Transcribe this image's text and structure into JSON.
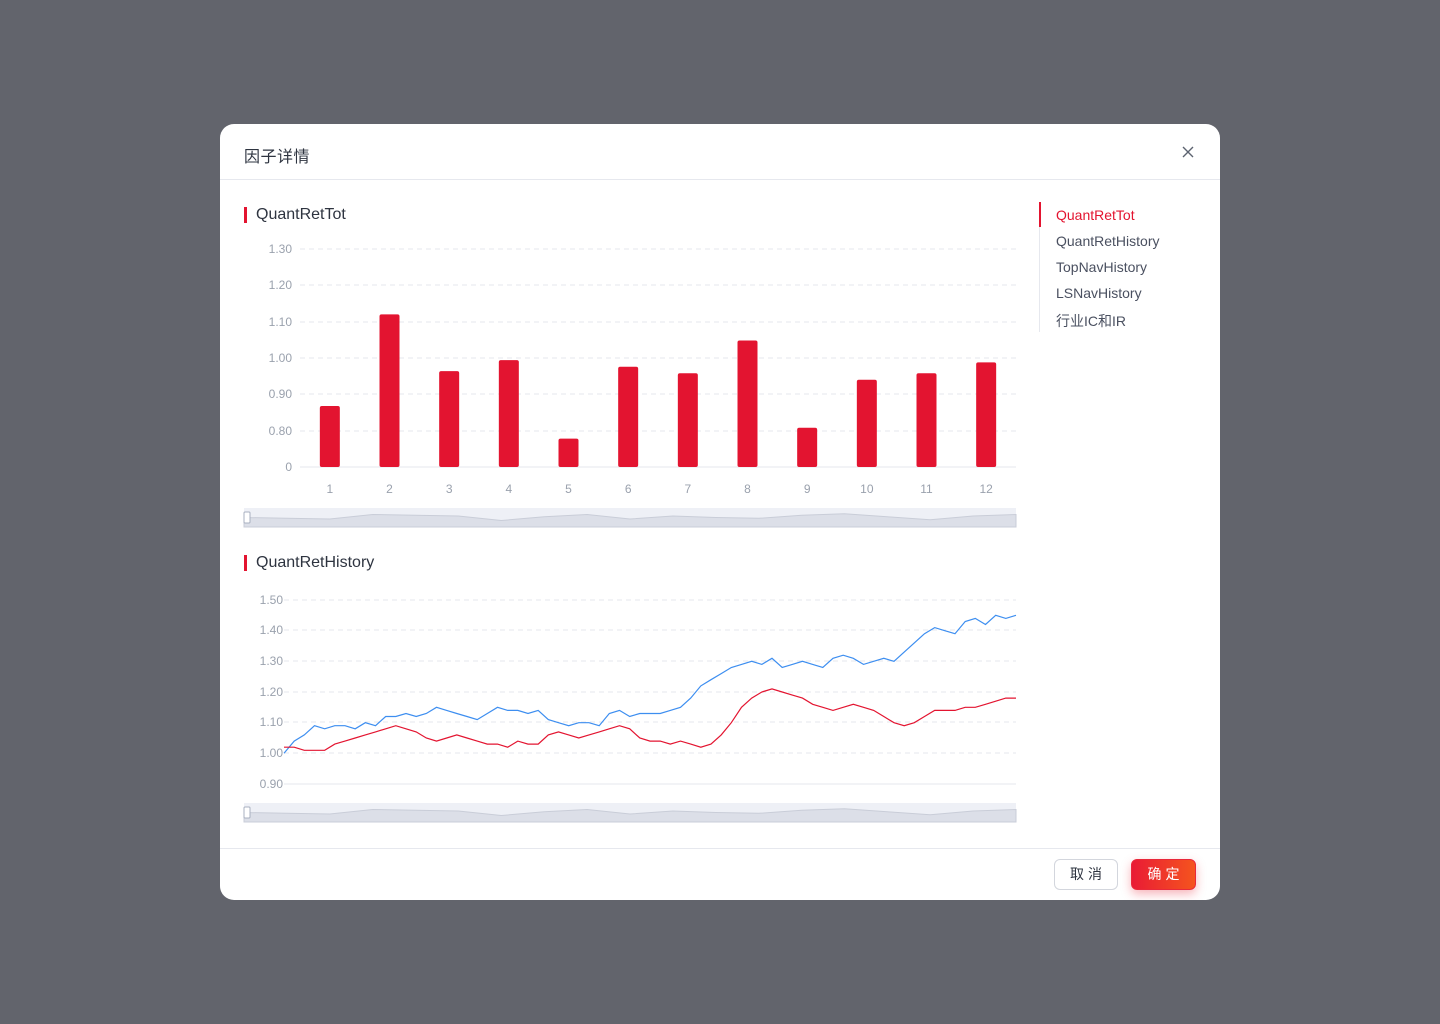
{
  "modal": {
    "title": "因子详情",
    "close_icon": "close-icon"
  },
  "sections": [
    {
      "title": "QuantRetTot"
    },
    {
      "title": "QuantRetHistory"
    }
  ],
  "anchor_nav": {
    "items": [
      "QuantRetTot",
      "QuantRetHistory",
      "TopNavHistory",
      "LSNavHistory",
      "行业IC和IR"
    ],
    "active_index": 0
  },
  "footer": {
    "cancel_label": "取消",
    "ok_label": "确定"
  },
  "colors": {
    "accent": "#e31430",
    "series_blue": "#3d8ef0",
    "series_red": "#e31430"
  },
  "chart_data": [
    {
      "type": "bar",
      "title": "QuantRetTot",
      "categories": [
        "1",
        "2",
        "3",
        "4",
        "5",
        "6",
        "7",
        "8",
        "9",
        "10",
        "11",
        "12"
      ],
      "values": [
        0.94,
        1.15,
        1.02,
        1.045,
        0.865,
        1.03,
        1.015,
        1.09,
        0.89,
        1.0,
        1.015,
        1.04
      ],
      "y_ticks": [
        "0",
        "0.80",
        "0.90",
        "1.00",
        "1.10",
        "1.20",
        "1.30"
      ],
      "ylim": [
        0.8,
        1.3
      ],
      "grid": true,
      "data_zoom": true
    },
    {
      "type": "line",
      "title": "QuantRetHistory",
      "y_ticks": [
        "0.90",
        "1.00",
        "1.10",
        "1.20",
        "1.30",
        "1.40",
        "1.50"
      ],
      "ylim": [
        0.9,
        1.5
      ],
      "grid": true,
      "data_zoom": true,
      "series": [
        {
          "color": "#3d8ef0",
          "values": [
            1.0,
            1.04,
            1.06,
            1.09,
            1.08,
            1.09,
            1.09,
            1.08,
            1.1,
            1.09,
            1.12,
            1.12,
            1.13,
            1.12,
            1.13,
            1.15,
            1.14,
            1.13,
            1.12,
            1.11,
            1.13,
            1.15,
            1.14,
            1.14,
            1.13,
            1.14,
            1.11,
            1.1,
            1.09,
            1.1,
            1.1,
            1.09,
            1.13,
            1.14,
            1.12,
            1.13,
            1.13,
            1.13,
            1.14,
            1.15,
            1.18,
            1.22,
            1.24,
            1.26,
            1.28,
            1.29,
            1.3,
            1.29,
            1.31,
            1.28,
            1.29,
            1.3,
            1.29,
            1.28,
            1.31,
            1.32,
            1.31,
            1.29,
            1.3,
            1.31,
            1.3,
            1.33,
            1.36,
            1.39,
            1.41,
            1.4,
            1.39,
            1.43,
            1.44,
            1.42,
            1.45,
            1.44,
            1.45
          ]
        },
        {
          "color": "#e31430",
          "values": [
            1.02,
            1.02,
            1.01,
            1.01,
            1.01,
            1.03,
            1.04,
            1.05,
            1.06,
            1.07,
            1.08,
            1.09,
            1.08,
            1.07,
            1.05,
            1.04,
            1.05,
            1.06,
            1.05,
            1.04,
            1.03,
            1.03,
            1.02,
            1.04,
            1.03,
            1.03,
            1.06,
            1.07,
            1.06,
            1.05,
            1.06,
            1.07,
            1.08,
            1.09,
            1.08,
            1.05,
            1.04,
            1.04,
            1.03,
            1.04,
            1.03,
            1.02,
            1.03,
            1.06,
            1.1,
            1.15,
            1.18,
            1.2,
            1.21,
            1.2,
            1.19,
            1.18,
            1.16,
            1.15,
            1.14,
            1.15,
            1.16,
            1.15,
            1.14,
            1.12,
            1.1,
            1.09,
            1.1,
            1.12,
            1.14,
            1.14,
            1.14,
            1.15,
            1.15,
            1.16,
            1.17,
            1.18,
            1.18
          ]
        }
      ]
    }
  ]
}
